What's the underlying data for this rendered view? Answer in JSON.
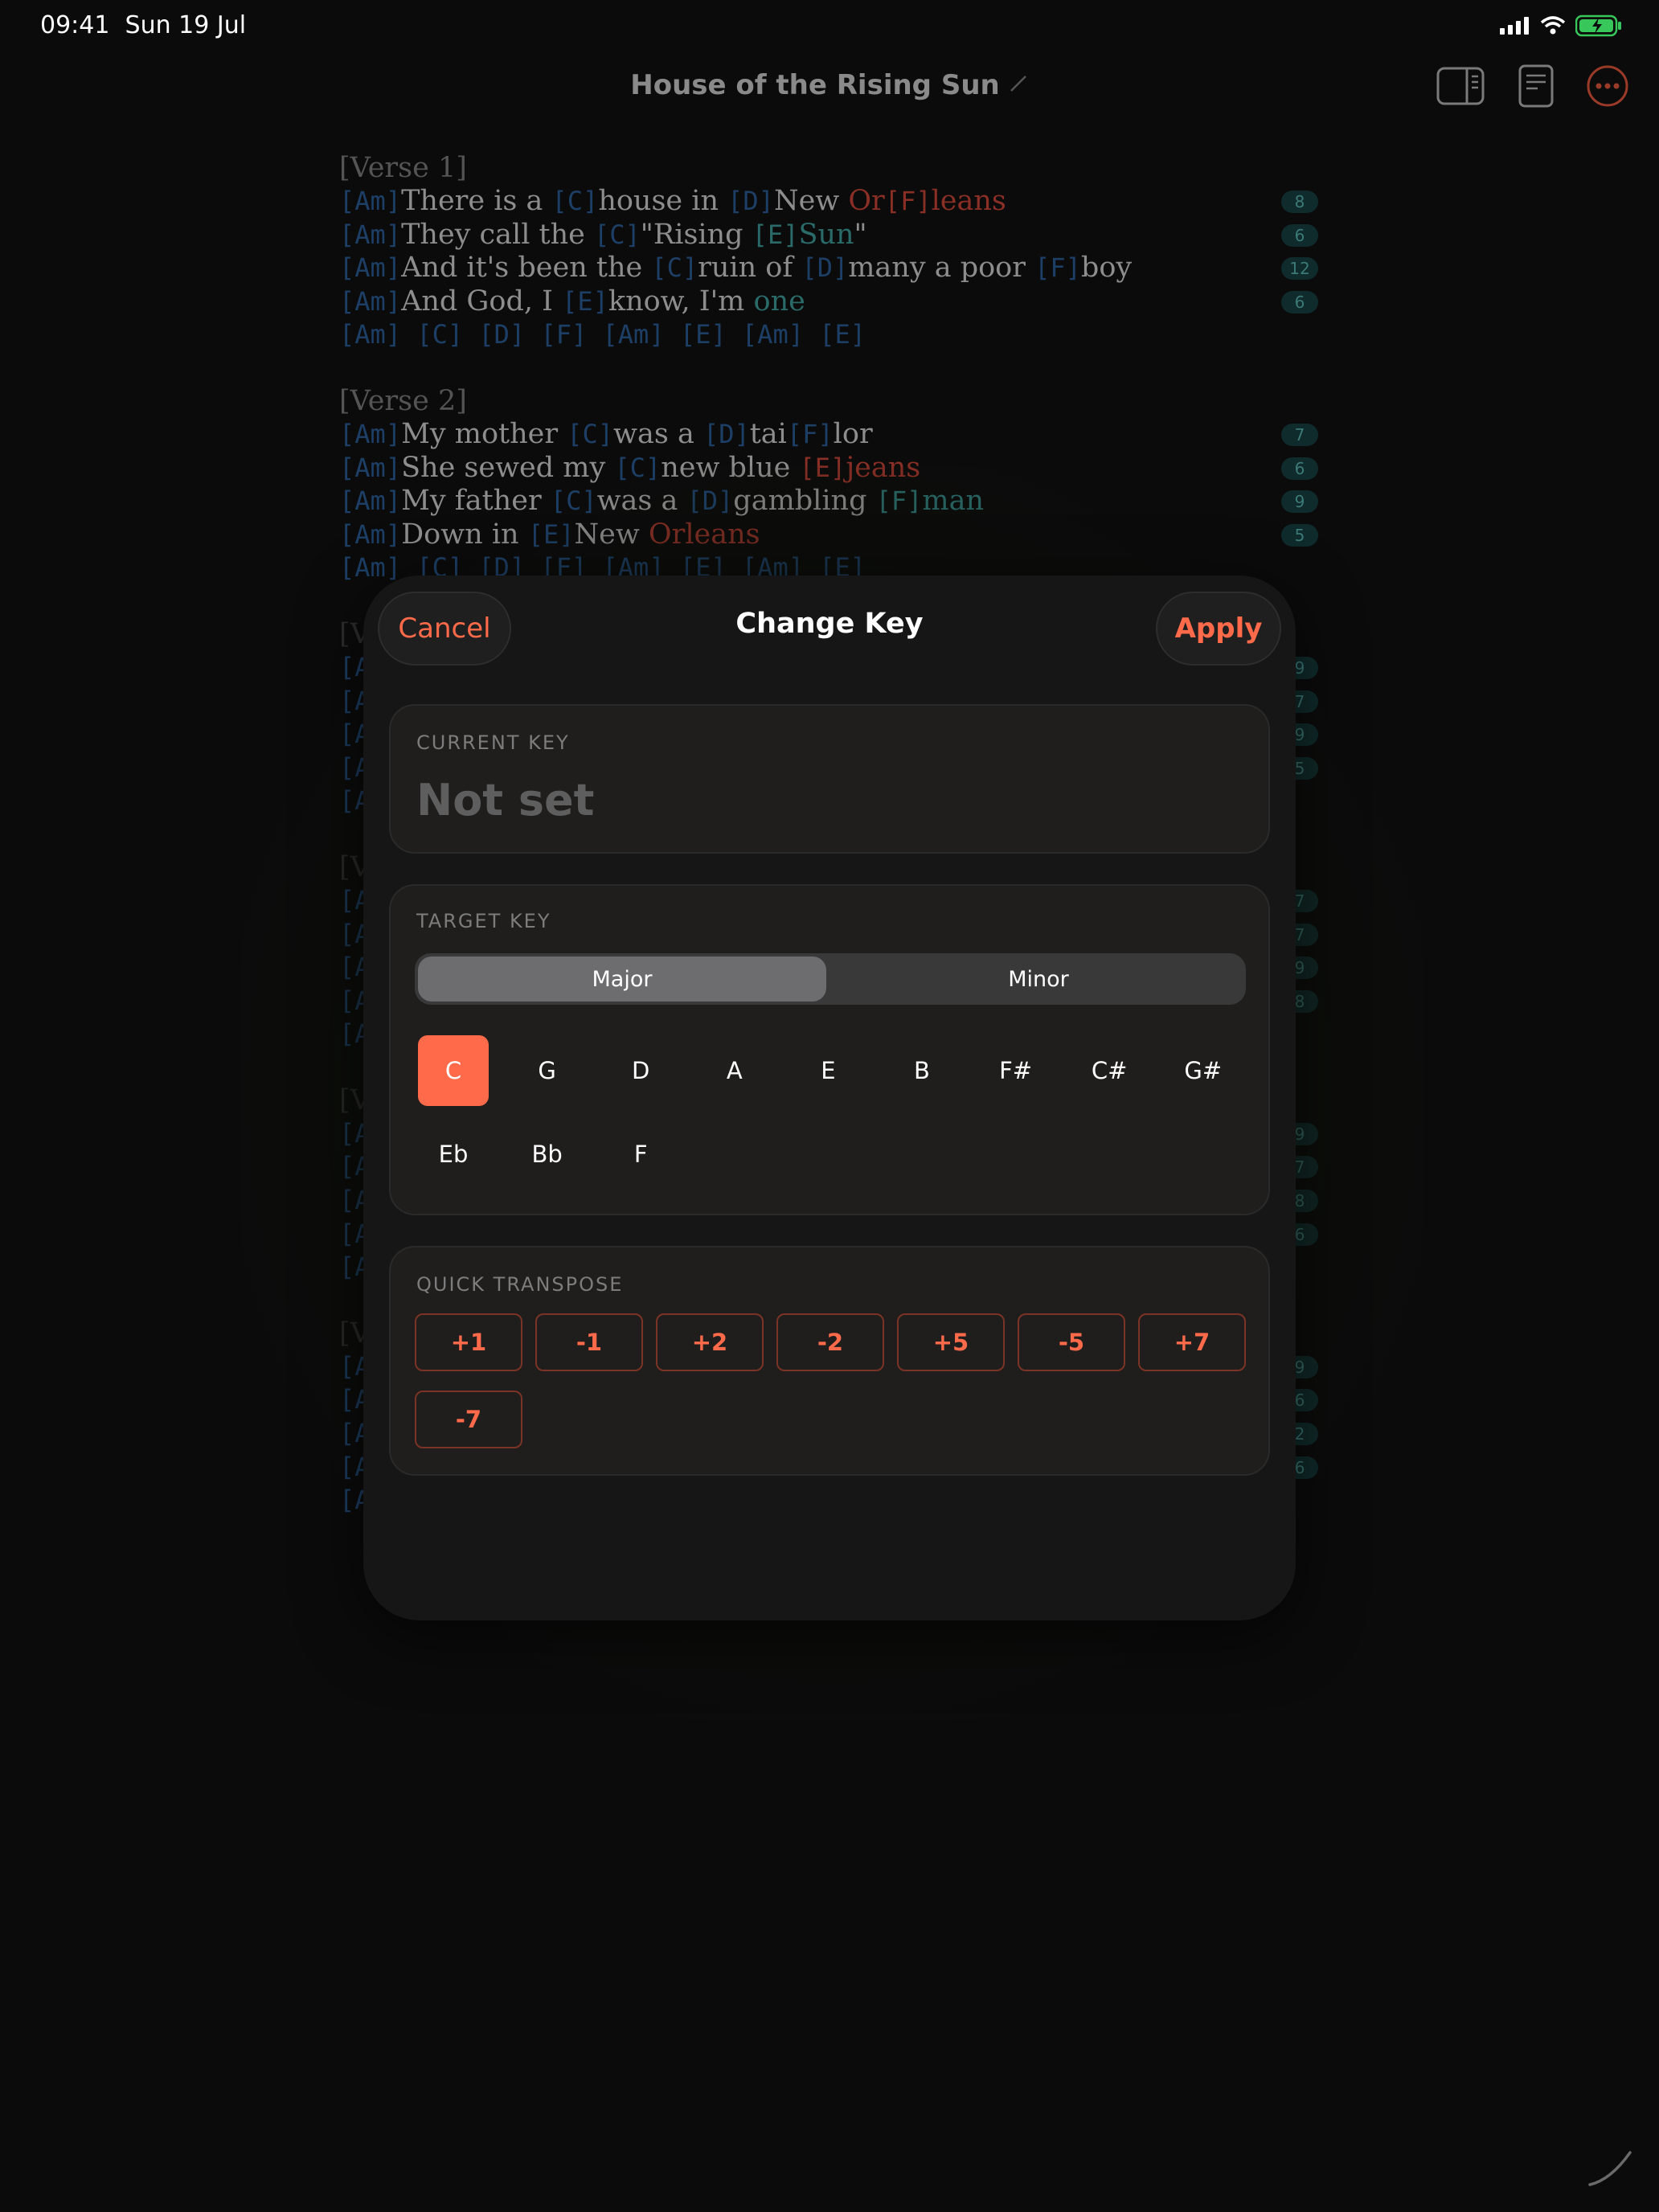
{
  "status": {
    "time": "09:41",
    "date": "Sun 19 Jul"
  },
  "header": {
    "title": "House of the Rising Sun"
  },
  "lyrics": {
    "sections": [
      {
        "label": "[Verse 1]",
        "lines": [
          {
            "parts": [
              [
                "c",
                "[Am]"
              ],
              [
                "t",
                "There is a "
              ],
              [
                "c",
                "[C]"
              ],
              [
                "t",
                "house in "
              ],
              [
                "c",
                "[D]"
              ],
              [
                "t",
                "New "
              ],
              [
                "tr",
                "Or"
              ],
              [
                "cr",
                "[F]"
              ],
              [
                "tr",
                "leans"
              ]
            ],
            "count": "8"
          },
          {
            "parts": [
              [
                "c",
                "[Am]"
              ],
              [
                "t",
                "They call the "
              ],
              [
                "c",
                "[C]"
              ],
              [
                "t",
                "\"Rising "
              ],
              [
                "ct",
                "[E]"
              ],
              [
                "tt",
                "Sun"
              ],
              [
                "t",
                "\""
              ]
            ],
            "count": "6"
          },
          {
            "parts": [
              [
                "c",
                "[Am]"
              ],
              [
                "t",
                "And it's been the "
              ],
              [
                "c",
                "[C]"
              ],
              [
                "t",
                "ruin of "
              ],
              [
                "c",
                "[D]"
              ],
              [
                "t",
                "many a poor "
              ],
              [
                "c",
                "[F]"
              ],
              [
                "t",
                "boy"
              ]
            ],
            "count": "12"
          },
          {
            "parts": [
              [
                "c",
                "[Am]"
              ],
              [
                "t",
                "And God, I "
              ],
              [
                "c",
                "[E]"
              ],
              [
                "t",
                "know, I'm "
              ],
              [
                "tt",
                "one"
              ]
            ],
            "count": "6"
          }
        ],
        "chord_row": "[Am] [C] [D] [F] [Am] [E] [Am] [E]"
      },
      {
        "label": "[Verse 2]",
        "lines": [
          {
            "parts": [
              [
                "c",
                "[Am]"
              ],
              [
                "t",
                "My mother "
              ],
              [
                "c",
                "[C]"
              ],
              [
                "t",
                "was a "
              ],
              [
                "c",
                "[D]"
              ],
              [
                "t",
                "tai"
              ],
              [
                "c",
                "[F]"
              ],
              [
                "t",
                "lor"
              ]
            ],
            "count": "7"
          },
          {
            "parts": [
              [
                "c",
                "[Am]"
              ],
              [
                "t",
                "She sewed my "
              ],
              [
                "c",
                "[C]"
              ],
              [
                "t",
                "new blue "
              ],
              [
                "cr",
                "[E]"
              ],
              [
                "tr",
                "jeans"
              ]
            ],
            "count": "6"
          },
          {
            "parts": [
              [
                "c",
                "[Am]"
              ],
              [
                "t",
                "My father "
              ],
              [
                "c",
                "[C]"
              ],
              [
                "t",
                "was a "
              ],
              [
                "c",
                "[D]"
              ],
              [
                "t",
                "gambling "
              ],
              [
                "ct",
                "[F]"
              ],
              [
                "tt",
                "man"
              ]
            ],
            "count": "9"
          },
          {
            "parts": [
              [
                "c",
                "[Am]"
              ],
              [
                "t",
                "Down in "
              ],
              [
                "c",
                "[E]"
              ],
              [
                "t",
                "New "
              ],
              [
                "tr",
                "Orleans"
              ]
            ],
            "count": "5"
          }
        ],
        "chord_row": "[Am] [C] [D] [F] [Am] [E] [Am] [E]"
      }
    ],
    "hidden_sections": [
      {
        "label_stub": "[V",
        "line_stubs": [
          "[A",
          "[A",
          "[A",
          "[A"
        ],
        "counts": [
          "9",
          "7",
          "9",
          "5"
        ],
        "chord_stub": "[A"
      },
      {
        "label_stub": "[V",
        "line_stubs": [
          "[A",
          "[A",
          "[A",
          "[A"
        ],
        "counts": [
          "7",
          "7",
          "9",
          "8"
        ],
        "chord_stub": "[A"
      },
      {
        "label_stub": "[V",
        "line_stubs": [
          "[A",
          "[A",
          "[A",
          "[A"
        ],
        "counts": [
          "9",
          "7",
          "8",
          "6"
        ],
        "chord_stub": "[A"
      },
      {
        "label_stub": "[V",
        "line_stubs": [
          "[A",
          "[A",
          "[A",
          "[A"
        ],
        "counts": [
          "9",
          "6",
          "2",
          "6"
        ],
        "chord_stub": "[A"
      }
    ]
  },
  "modal": {
    "title": "Change Key",
    "cancel_label": "Cancel",
    "apply_label": "Apply",
    "current_key": {
      "label": "CURRENT KEY",
      "value": "Not set"
    },
    "target_key": {
      "label": "TARGET KEY",
      "modes": [
        "Major",
        "Minor"
      ],
      "selected_mode": "Major",
      "keys": [
        "C",
        "G",
        "D",
        "A",
        "E",
        "B",
        "F#",
        "C#",
        "G#",
        "Eb",
        "Bb",
        "F"
      ],
      "selected_key": "C"
    },
    "quick_transpose": {
      "label": "QUICK TRANSPOSE",
      "steps": [
        "+1",
        "-1",
        "+2",
        "-2",
        "+5",
        "-5",
        "+7",
        "-7"
      ]
    }
  },
  "colors": {
    "accent": "#ff6b4a",
    "chord_blue": "#1d3f66",
    "chord_red": "#8a2f26",
    "chord_teal": "#2a6b6a"
  }
}
